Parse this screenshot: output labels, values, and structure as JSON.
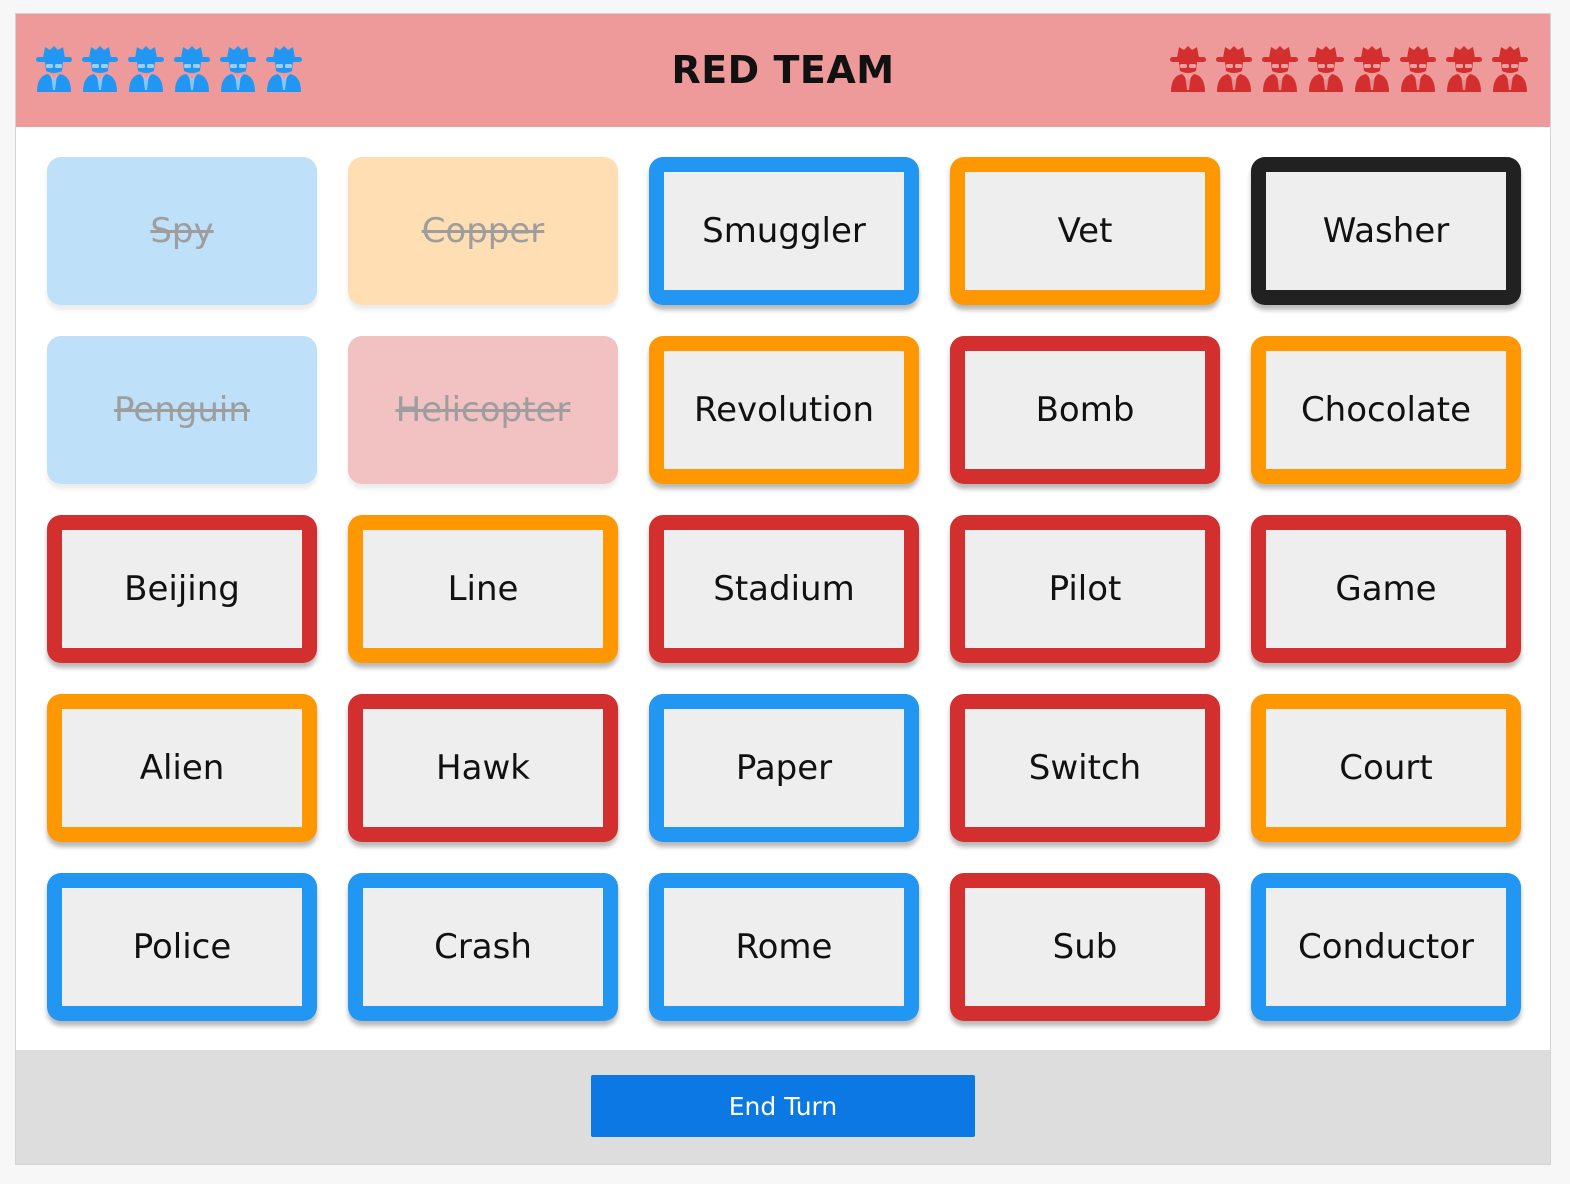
{
  "header": {
    "title": "RED TEAM",
    "background": "#ef9a9a",
    "blue_agents_remaining": 6,
    "red_agents_remaining": 8
  },
  "colors": {
    "red": "#d32f2f",
    "blue": "#2196f3",
    "neutral": "#ff9800",
    "assassin": "#212121",
    "revealed_red": "#f2c1c1",
    "revealed_blue": "#bee0f9",
    "revealed_neutral": "#ffdeb3",
    "card_face": "#eeeeee",
    "end_turn": "#0b78e3"
  },
  "cards": [
    {
      "word": "Spy",
      "team": "blue",
      "revealed": true
    },
    {
      "word": "Copper",
      "team": "neutral",
      "revealed": true
    },
    {
      "word": "Smuggler",
      "team": "blue",
      "revealed": false
    },
    {
      "word": "Vet",
      "team": "neutral",
      "revealed": false
    },
    {
      "word": "Washer",
      "team": "assassin",
      "revealed": false
    },
    {
      "word": "Penguin",
      "team": "blue",
      "revealed": true
    },
    {
      "word": "Helicopter",
      "team": "red",
      "revealed": true
    },
    {
      "word": "Revolution",
      "team": "neutral",
      "revealed": false
    },
    {
      "word": "Bomb",
      "team": "red",
      "revealed": false
    },
    {
      "word": "Chocolate",
      "team": "neutral",
      "revealed": false
    },
    {
      "word": "Beijing",
      "team": "red",
      "revealed": false
    },
    {
      "word": "Line",
      "team": "neutral",
      "revealed": false
    },
    {
      "word": "Stadium",
      "team": "red",
      "revealed": false
    },
    {
      "word": "Pilot",
      "team": "red",
      "revealed": false
    },
    {
      "word": "Game",
      "team": "red",
      "revealed": false
    },
    {
      "word": "Alien",
      "team": "neutral",
      "revealed": false
    },
    {
      "word": "Hawk",
      "team": "red",
      "revealed": false
    },
    {
      "word": "Paper",
      "team": "blue",
      "revealed": false
    },
    {
      "word": "Switch",
      "team": "red",
      "revealed": false
    },
    {
      "word": "Court",
      "team": "neutral",
      "revealed": false
    },
    {
      "word": "Police",
      "team": "blue",
      "revealed": false
    },
    {
      "word": "Crash",
      "team": "blue",
      "revealed": false
    },
    {
      "word": "Rome",
      "team": "blue",
      "revealed": false
    },
    {
      "word": "Sub",
      "team": "red",
      "revealed": false
    },
    {
      "word": "Conductor",
      "team": "blue",
      "revealed": false
    }
  ],
  "footer": {
    "end_turn_label": "End Turn"
  }
}
